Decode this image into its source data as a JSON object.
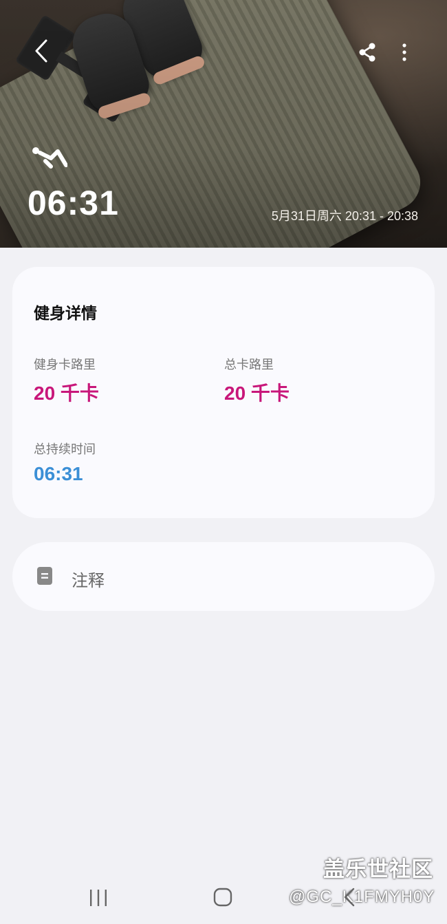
{
  "header": {
    "back_icon": "chevron-left-icon",
    "share_icon": "share-icon",
    "more_icon": "more-vertical-icon",
    "workout_icon": "workout-icon",
    "duration": "06:31",
    "time_range": "5月31日周六 20:31 - 20:38"
  },
  "details": {
    "title": "健身详情",
    "metrics": [
      {
        "label": "健身卡路里",
        "value": "20 千卡"
      },
      {
        "label": "总卡路里",
        "value": "20 千卡"
      },
      {
        "label": "总持续时间",
        "value": "06:31"
      }
    ]
  },
  "notes": {
    "icon": "note-icon",
    "label": "注释"
  },
  "watermark": {
    "title": "盖乐世社区",
    "handle": "@GC_K1FMYH0Y"
  },
  "colors": {
    "calorie_value": "#c8177a",
    "duration_value": "#3b8fd6",
    "page_background": "#f1f1f5",
    "card_background": "#fafafe"
  }
}
